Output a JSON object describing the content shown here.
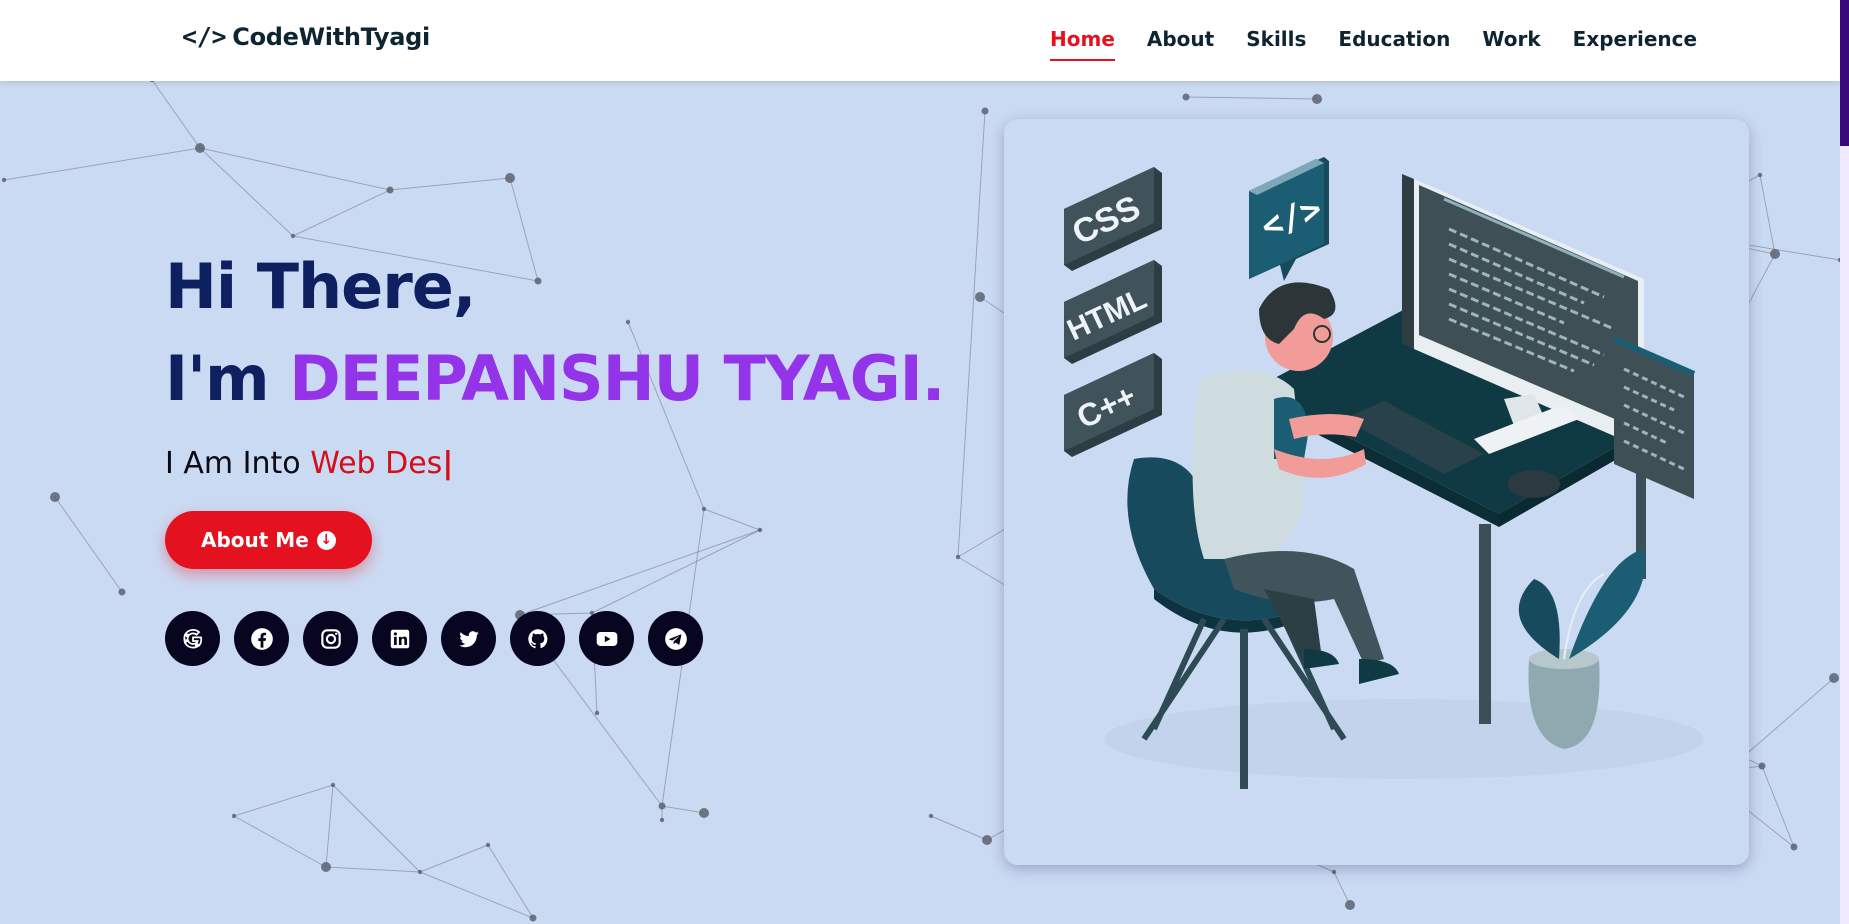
{
  "header": {
    "logo_icon": "</>",
    "logo_text": "CodeWithTyagi",
    "nav": [
      {
        "label": "Home",
        "active": true
      },
      {
        "label": "About"
      },
      {
        "label": "Skills"
      },
      {
        "label": "Education"
      },
      {
        "label": "Work"
      },
      {
        "label": "Experience"
      }
    ]
  },
  "hero": {
    "greeting": "Hi There,",
    "name_prefix": "I'm ",
    "name": "DEEPANSHU TYAGI.",
    "typing_prefix": "I Am Into ",
    "typing_text": "Web Des",
    "cursor": "|",
    "about_button": "About Me",
    "about_button_icon": "arrow-down-circle-icon"
  },
  "socials": [
    {
      "name": "google",
      "icon": "google-icon"
    },
    {
      "name": "facebook",
      "icon": "facebook-icon"
    },
    {
      "name": "instagram",
      "icon": "instagram-icon"
    },
    {
      "name": "linkedin",
      "icon": "linkedin-icon"
    },
    {
      "name": "twitter",
      "icon": "twitter-icon"
    },
    {
      "name": "github",
      "icon": "github-icon"
    },
    {
      "name": "youtube",
      "icon": "youtube-icon"
    },
    {
      "name": "telegram",
      "icon": "telegram-icon"
    }
  ],
  "illustration": {
    "tags": [
      "CSS",
      "HTML",
      "C++"
    ],
    "code_badge": "</>"
  },
  "colors": {
    "background": "#cbdaf3",
    "accent_red": "#e4121e",
    "name_purple": "#9434e8",
    "heading_navy": "#0e2060",
    "social_bg": "#070520"
  }
}
